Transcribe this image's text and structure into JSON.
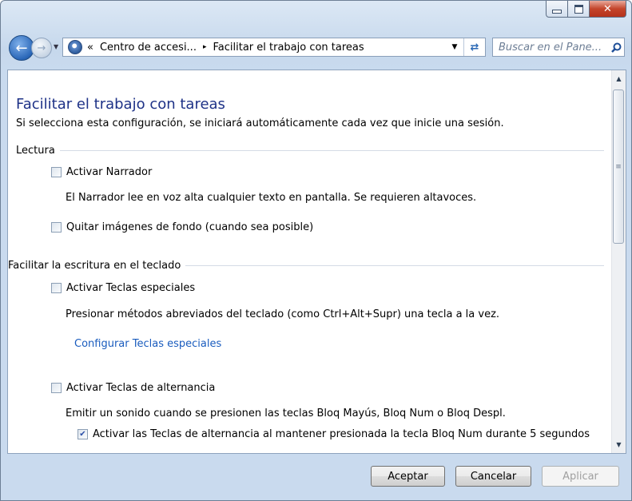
{
  "window": {
    "caption_buttons": {
      "minimize_icon": "minimize-icon",
      "maximize_icon": "maximize-icon",
      "close_icon": "close-icon"
    }
  },
  "nav": {
    "back_icon": "back-arrow-icon",
    "forward_icon": "forward-arrow-icon",
    "address": {
      "prefix": "«",
      "segments": [
        "Centro de accesi...",
        "Facilitar el trabajo con tareas"
      ],
      "separator": "▸"
    },
    "search": {
      "placeholder": "Buscar en el Pane..."
    }
  },
  "page": {
    "title": "Facilitar el trabajo con tareas",
    "subtitle": "Si selecciona esta configuración, se iniciará automáticamente cada vez que inicie una sesión.",
    "sections": [
      {
        "heading": "Lectura",
        "narrator": {
          "label": "Activar Narrador",
          "checked": false,
          "description": "El Narrador lee en voz alta cualquier texto en pantalla. Se requieren altavoces."
        },
        "remove_bg": {
          "label": "Quitar imágenes de fondo (cuando sea posible)",
          "checked": false
        }
      },
      {
        "heading": "Facilitar la escritura en el teclado",
        "sticky_keys": {
          "label": "Activar Teclas especiales",
          "checked": false,
          "description": "Presionar métodos abreviados del teclado (como Ctrl+Alt+Supr) una tecla a la vez.",
          "link": "Configurar Teclas especiales"
        },
        "toggle_keys": {
          "label": "Activar Teclas de alternancia",
          "checked": false,
          "description": "Emitir un sonido cuando se presionen las teclas Bloq Mayús, Bloq Num o Bloq Despl.",
          "sub_option": {
            "label": "Activar las Teclas de alternancia al mantener presionada la tecla Bloq Num durante 5 segundos",
            "checked": true
          }
        }
      }
    ]
  },
  "buttons": {
    "ok": "Aceptar",
    "cancel": "Cancelar",
    "apply": "Aplicar"
  }
}
